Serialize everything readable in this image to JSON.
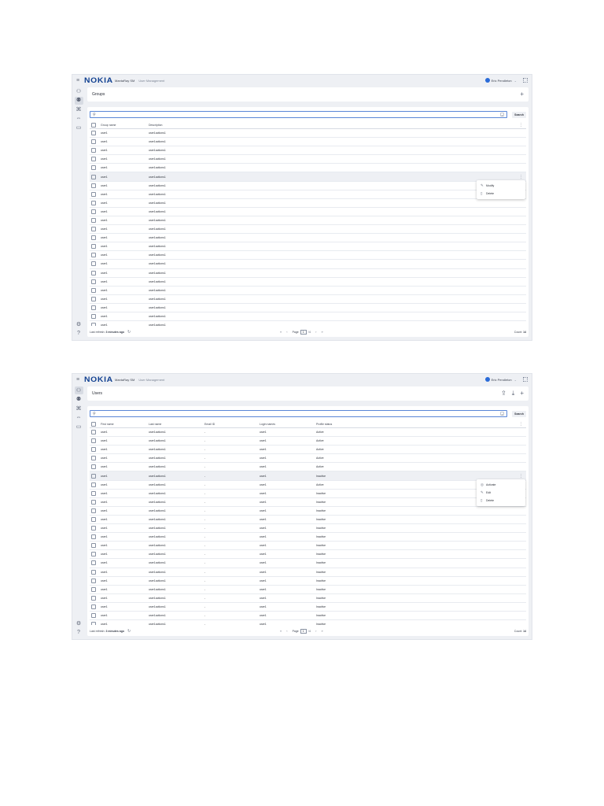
{
  "header": {
    "menu_icon": "hamburger-icon",
    "logo": "NOKIA",
    "app_name": "MantaRay SM",
    "app_section": "User Management",
    "user_name": "Eric Pendleton",
    "apps_icon": "app-grid-icon"
  },
  "groups": {
    "title": "Groups",
    "search_placeholder": "",
    "search_button": "Search",
    "columns": [
      "Group name",
      "Description"
    ],
    "row_name": "user1",
    "row_desc": "user1actions1",
    "rows": [
      {
        "name": "user1",
        "description": "user1actions1"
      },
      {
        "name": "user1",
        "description": "user1actions1"
      },
      {
        "name": "user1",
        "description": "user1actions1"
      },
      {
        "name": "user1",
        "description": "user1actions1"
      },
      {
        "name": "user1",
        "description": "user1actions1"
      },
      {
        "name": "user1",
        "description": "user1actions1"
      },
      {
        "name": "user1",
        "description": "user1actions1"
      },
      {
        "name": "user1",
        "description": "user1actions1"
      },
      {
        "name": "user1",
        "description": "user1actions1"
      },
      {
        "name": "user1",
        "description": "user1actions1"
      },
      {
        "name": "user1",
        "description": "user1actions1"
      },
      {
        "name": "user1",
        "description": "user1actions1"
      },
      {
        "name": "user1",
        "description": "user1actions1"
      },
      {
        "name": "user1",
        "description": "user1actions1"
      },
      {
        "name": "user1",
        "description": "user1actions1"
      },
      {
        "name": "user1",
        "description": "user1actions1"
      },
      {
        "name": "user1",
        "description": "user1actions1"
      },
      {
        "name": "user1",
        "description": "user1actions1"
      },
      {
        "name": "user1",
        "description": "user1actions1"
      },
      {
        "name": "user1",
        "description": "user1actions1"
      },
      {
        "name": "user1",
        "description": "user1actions1"
      },
      {
        "name": "user1",
        "description": "user1actions1"
      },
      {
        "name": "user1",
        "description": "user1actions1"
      },
      {
        "name": "user1",
        "description": "user1actions1"
      }
    ],
    "highlighted_row_index": 5,
    "menu": [
      {
        "icon": "pencil-icon",
        "label": "Modify"
      },
      {
        "icon": "trash-icon",
        "label": "Delete"
      }
    ],
    "footer": {
      "refresh_label": "Last refresh:",
      "refresh_value": "3 minutes ago",
      "page_label": "Page",
      "page_value": "1",
      "page_total": "/4",
      "count_label": "Count:",
      "count_value": "14"
    }
  },
  "users": {
    "title": "Users",
    "search_placeholder": "",
    "search_button": "Search",
    "columns": [
      "First name",
      "Last name",
      "Email ID",
      "Login names",
      "Profile status"
    ],
    "rows": [
      {
        "first": "user1",
        "last": "user1actions1",
        "email": "-",
        "login": "user1",
        "status": "Active"
      },
      {
        "first": "user1",
        "last": "user1actions1",
        "email": "-",
        "login": "user1",
        "status": "Active"
      },
      {
        "first": "user1",
        "last": "user1actions1",
        "email": "-",
        "login": "user1",
        "status": "Active"
      },
      {
        "first": "user1",
        "last": "user1actions1",
        "email": "-",
        "login": "user1",
        "status": "Active"
      },
      {
        "first": "user1",
        "last": "user1actions1",
        "email": "-",
        "login": "user1",
        "status": "Active"
      },
      {
        "first": "user1",
        "last": "user1actions1",
        "email": "-",
        "login": "user1",
        "status": "Inactive"
      },
      {
        "first": "user1",
        "last": "user1actions1",
        "email": "-",
        "login": "user1",
        "status": "Active"
      },
      {
        "first": "user1",
        "last": "user1actions1",
        "email": "-",
        "login": "user1",
        "status": "Inactive"
      },
      {
        "first": "user1",
        "last": "user1actions1",
        "email": "-",
        "login": "user1",
        "status": "Inactive"
      },
      {
        "first": "user1",
        "last": "user1actions1",
        "email": "-",
        "login": "user1",
        "status": "Inactive"
      },
      {
        "first": "user1",
        "last": "user1actions1",
        "email": "-",
        "login": "user1",
        "status": "Inactive"
      },
      {
        "first": "user1",
        "last": "user1actions1",
        "email": "-",
        "login": "user1",
        "status": "Inactive"
      },
      {
        "first": "user1",
        "last": "user1actions1",
        "email": "-",
        "login": "user1",
        "status": "Inactive"
      },
      {
        "first": "user1",
        "last": "user1actions1",
        "email": "-",
        "login": "user1",
        "status": "Inactive"
      },
      {
        "first": "user1",
        "last": "user1actions1",
        "email": "-",
        "login": "user1",
        "status": "Inactive"
      },
      {
        "first": "user1",
        "last": "user1actions1",
        "email": "-",
        "login": "user1",
        "status": "Inactive"
      },
      {
        "first": "user1",
        "last": "user1actions1",
        "email": "-",
        "login": "user1",
        "status": "Inactive"
      },
      {
        "first": "user1",
        "last": "user1actions1",
        "email": "-",
        "login": "user1",
        "status": "Inactive"
      },
      {
        "first": "user1",
        "last": "user1actions1",
        "email": "-",
        "login": "user1",
        "status": "Inactive"
      },
      {
        "first": "user1",
        "last": "user1actions1",
        "email": "-",
        "login": "user1",
        "status": "Inactive"
      },
      {
        "first": "user1",
        "last": "user1actions1",
        "email": "-",
        "login": "user1",
        "status": "Inactive"
      },
      {
        "first": "user1",
        "last": "user1actions1",
        "email": "-",
        "login": "user1",
        "status": "Inactive"
      },
      {
        "first": "user1",
        "last": "user1actions1",
        "email": "-",
        "login": "user1",
        "status": "Inactive"
      },
      {
        "first": "user1",
        "last": "user1actions1",
        "email": "-",
        "login": "user1",
        "status": "Inactive"
      }
    ],
    "highlighted_row_index": 5,
    "menu": [
      {
        "icon": "activate-icon",
        "label": "Activate"
      },
      {
        "icon": "pencil-icon",
        "label": "Edit"
      },
      {
        "icon": "trash-icon",
        "label": "Delete"
      }
    ],
    "footer": {
      "refresh_label": "Last refresh:",
      "refresh_value": "3 minutes ago",
      "page_label": "Page",
      "page_value": "1",
      "page_total": "/4",
      "count_label": "Count:",
      "count_value": "14"
    }
  }
}
